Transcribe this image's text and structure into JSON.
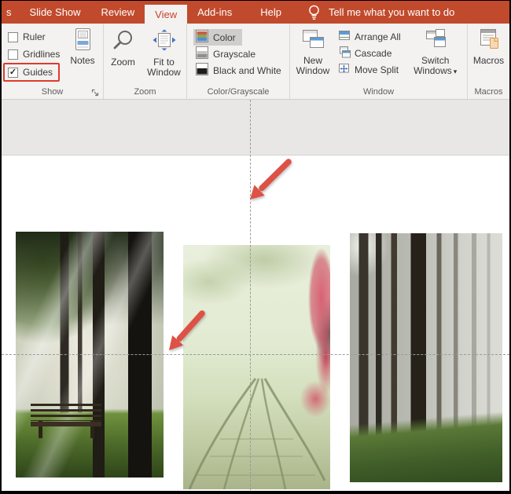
{
  "colors": {
    "ribbon_red": "#c14a2c",
    "active_tab_text": "#c8432c",
    "guides_highlight_red": "#e03a2c",
    "arrow_red": "#de5145",
    "guide_gray": "#9b9b9b",
    "selected_item_bg": "#d0cecb",
    "accent_blue": "#5b9bd5"
  },
  "tabbar": {
    "partial_tab": "s",
    "tabs": [
      {
        "label": "Slide Show",
        "active": false
      },
      {
        "label": "Review",
        "active": false
      },
      {
        "label": "View",
        "active": true
      },
      {
        "label": "Add-ins",
        "active": false
      },
      {
        "label": "Help",
        "active": false
      }
    ],
    "tell_me": "Tell me what you want to do"
  },
  "ribbon": {
    "show": {
      "label": "Show",
      "checkboxes": [
        {
          "label": "Ruler",
          "checked": false,
          "check": ""
        },
        {
          "label": "Gridlines",
          "checked": false,
          "check": ""
        },
        {
          "label": "Guides",
          "checked": true,
          "check": "✓",
          "highlighted": true
        }
      ],
      "notes": "Notes"
    },
    "zoom": {
      "label": "Zoom",
      "zoom_button": "Zoom",
      "fit_button_line1": "Fit to",
      "fit_button_line2": "Window"
    },
    "color_grayscale": {
      "label": "Color/Grayscale",
      "items": [
        {
          "label": "Color",
          "selected": true
        },
        {
          "label": "Grayscale",
          "selected": false
        },
        {
          "label": "Black and White",
          "selected": false
        }
      ]
    },
    "window": {
      "label": "Window",
      "new_window_line1": "New",
      "new_window_line2": "Window",
      "items": [
        {
          "label": "Arrange All"
        },
        {
          "label": "Cascade"
        },
        {
          "label": "Move Split"
        }
      ],
      "switch_line1": "Switch",
      "switch_line2": "Windows",
      "caret": "▾"
    },
    "macros": {
      "label": "Macros",
      "button": "Macros"
    }
  },
  "canvas": {
    "photos": [
      {
        "name": "forest-park-photo"
      },
      {
        "name": "misty-railway-photo"
      },
      {
        "name": "foggy-pines-photo"
      }
    ]
  }
}
